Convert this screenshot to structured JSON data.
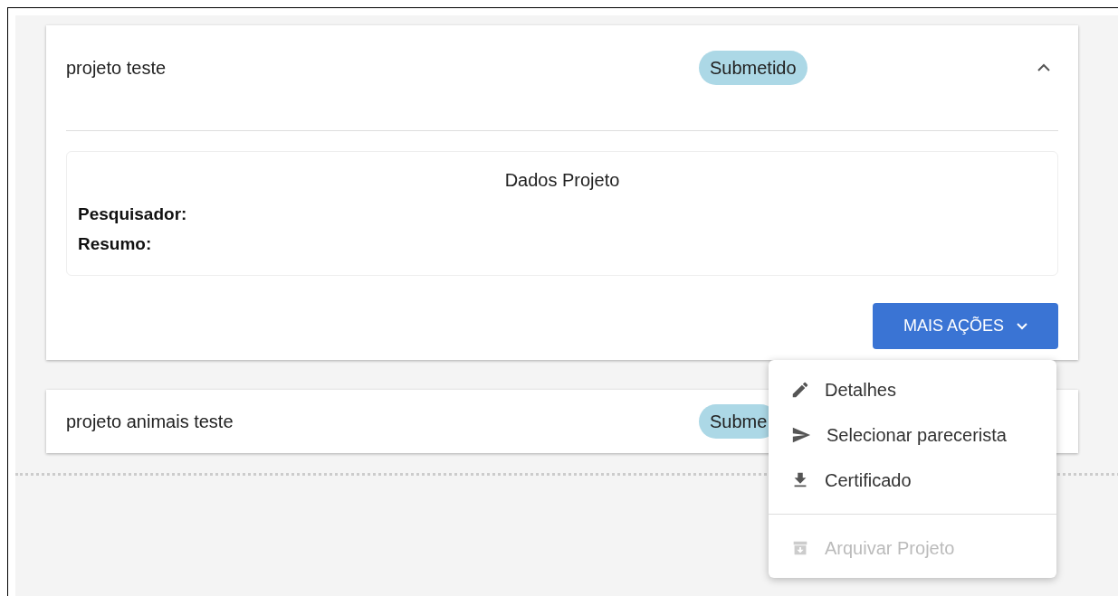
{
  "projects": [
    {
      "title": "projeto teste",
      "status": "Submetido",
      "expanded": true,
      "details": {
        "heading": "Dados Projeto",
        "fields": [
          "Pesquisador:",
          "Resumo:"
        ]
      },
      "action_button": "MAIS AÇÕES"
    },
    {
      "title": "projeto animais teste",
      "status": "Subme",
      "expanded": false
    }
  ],
  "menu": [
    {
      "kind": "edit",
      "label": "Detalhes",
      "disabled": false
    },
    {
      "kind": "send",
      "label": "Selecionar parecerista",
      "disabled": false
    },
    {
      "kind": "download",
      "label": "Certificado",
      "disabled": false
    },
    {
      "kind": "archive",
      "label": "Arquivar Projeto",
      "disabled": true
    }
  ]
}
